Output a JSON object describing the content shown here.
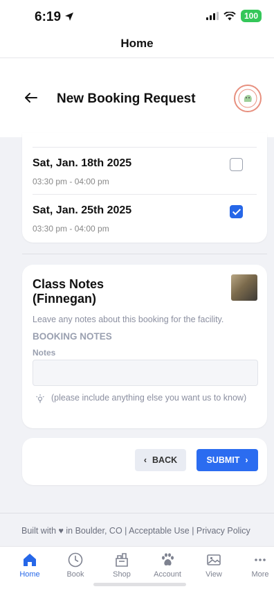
{
  "status": {
    "time": "6:19",
    "battery": "100"
  },
  "app_header": {
    "title": "Home"
  },
  "page": {
    "title": "New Booking Request"
  },
  "sessions": [
    {
      "date": "Sat, Jan. 18th 2025",
      "time": "03:30 pm - 04:00 pm",
      "checked": false
    },
    {
      "date": "Sat, Jan. 25th 2025",
      "time": "03:30 pm - 04:00 pm",
      "checked": true
    }
  ],
  "notes": {
    "title": "Class Notes (Finnegan)",
    "description": "Leave any notes about this booking for the facility.",
    "section_label": "BOOKING NOTES",
    "field_label": "Notes",
    "value": "",
    "hint": "(please include anything else you want us to know)"
  },
  "actions": {
    "back_label": "BACK",
    "submit_label": "SUBMIT"
  },
  "footer": {
    "text": "Built with ♥ in Boulder, CO | Acceptable Use | Privacy Policy"
  },
  "tabs": [
    {
      "label": "Home",
      "icon": "home-icon",
      "active": true
    },
    {
      "label": "Book",
      "icon": "clock-icon",
      "active": false
    },
    {
      "label": "Shop",
      "icon": "shop-icon",
      "active": false
    },
    {
      "label": "Account",
      "icon": "paw-icon",
      "active": false
    },
    {
      "label": "View",
      "icon": "image-icon",
      "active": false
    },
    {
      "label": "More",
      "icon": "more-icon",
      "active": false
    }
  ],
  "colors": {
    "accent": "#2b6cf0",
    "battery": "#34c759",
    "logo_ring": "#e78f7e"
  }
}
